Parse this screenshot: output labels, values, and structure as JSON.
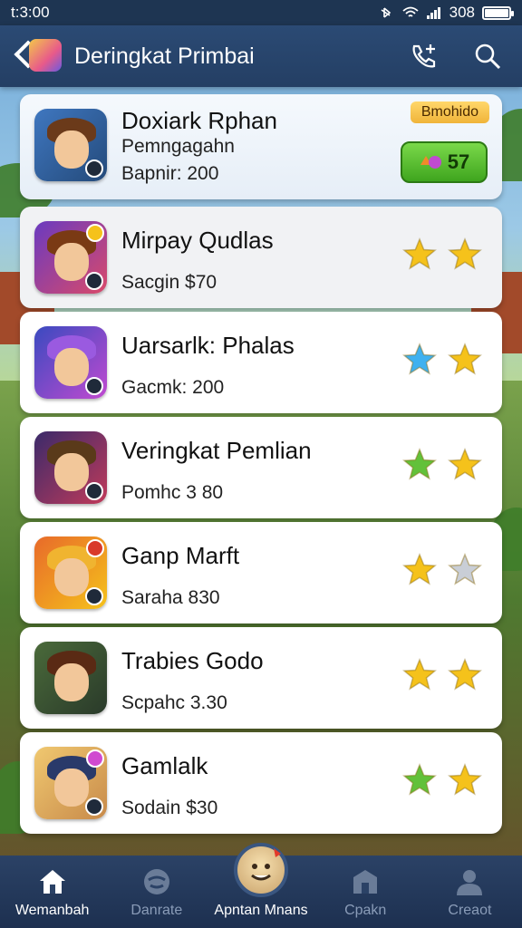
{
  "status_bar": {
    "time": "t:3:00",
    "battery": "308"
  },
  "header": {
    "title": "Deringkat Primbai"
  },
  "featured": {
    "title": "Doxiark Rphan",
    "subtitle": "Pemngagahn",
    "meta": "Bapnir: 200",
    "promo": "Bmohido",
    "price": "57"
  },
  "items": [
    {
      "title": "Mirpay Qudlas",
      "subtitle": "Sacgin $70",
      "stars": [
        "gold",
        "gold"
      ]
    },
    {
      "title": "Uarsarlk: Phalas",
      "subtitle": "Gacmk: 200",
      "stars": [
        "blue",
        "gold"
      ]
    },
    {
      "title": "Veringkat Pemlian",
      "subtitle": "Pomhc 3 80",
      "stars": [
        "green",
        "gold"
      ]
    },
    {
      "title": "Ganp Marft",
      "subtitle": "Saraha 830",
      "stars": [
        "gold",
        "silver"
      ]
    },
    {
      "title": "Trabies Godo",
      "subtitle": "Scpahc 3.30",
      "stars": [
        "gold",
        "gold"
      ]
    },
    {
      "title": "Gamlalk",
      "subtitle": "Sodain $30",
      "stars": [
        "green",
        "gold"
      ]
    }
  ],
  "nav": [
    {
      "label": "Wemanbah",
      "icon": "home-icon"
    },
    {
      "label": "Danrate",
      "icon": "game-icon"
    },
    {
      "label": "Apntan Mnans",
      "icon": "mascot-icon"
    },
    {
      "label": "Cpakn",
      "icon": "shop-icon"
    },
    {
      "label": "Creaot",
      "icon": "profile-icon"
    }
  ],
  "colors": {
    "gold": "#f5c21b",
    "blue": "#3fb1f0",
    "green": "#62c13a",
    "silver": "#c9ced6"
  }
}
